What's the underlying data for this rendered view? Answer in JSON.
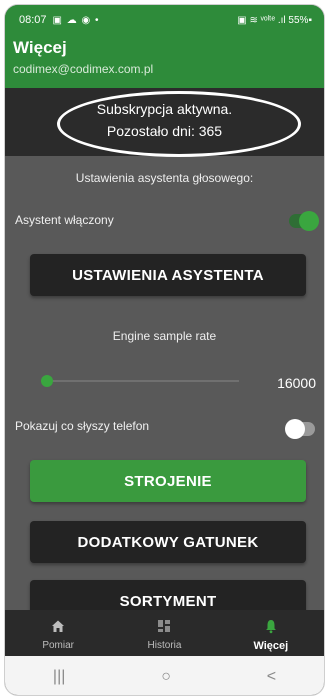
{
  "status": {
    "time": "08:07",
    "left_icons": "▣ ☁ ◉ •",
    "right": "▣ ≋ ᵛᵒˡᵗᵉ .ıl 55%▪"
  },
  "header": {
    "title": "Więcej",
    "email": "codimex@codimex.com.pl"
  },
  "subscription": {
    "line1": "Subskrypcja aktywna.",
    "line2": "Pozostało dni: 365"
  },
  "settings": {
    "section_label": "Ustawienia asystenta głosowego:",
    "assistant_label": "Asystent włączony",
    "assistant_on": true,
    "assistant_button": "USTAWIENIA ASYSTENTA",
    "sample_rate_label": "Engine sample rate",
    "sample_rate_value": "16000",
    "sample_rate_fraction": 0.03,
    "show_hearing_label": "Pokazuj co słyszy telefon",
    "show_hearing_on": false
  },
  "buttons": {
    "tuning": "STROJENIE",
    "extra_species": "DODATKOWY GATUNEK",
    "assortment": "SORTYMENT"
  },
  "nav": [
    {
      "label": "Pomiar",
      "icon": "home-icon"
    },
    {
      "label": "Historia",
      "icon": "grid-icon"
    },
    {
      "label": "Więcej",
      "icon": "bell-icon"
    }
  ],
  "system_nav": {
    "recents": "|||",
    "home": "○",
    "back": "<"
  },
  "colors": {
    "accent": "#3a9a3e",
    "appbar": "#2e8b3a",
    "background": "#595959"
  }
}
